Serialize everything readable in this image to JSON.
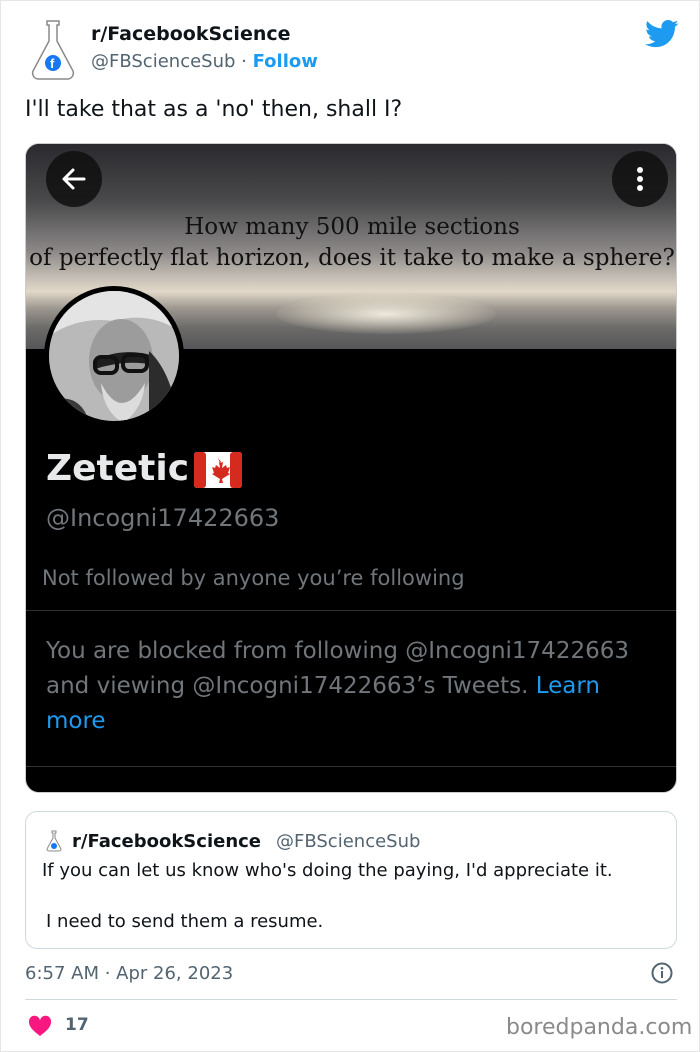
{
  "tweet": {
    "author_name": "r/FacebookScience",
    "author_handle": "@FBScienceSub",
    "separator": " · ",
    "follow_label": "Follow",
    "text": "I'll take that as a 'no' then, shall I?",
    "timestamp": "6:57 AM · Apr 26, 2023",
    "like_count": "17"
  },
  "embedded_profile": {
    "banner_line1": "How many 500 mile sections",
    "banner_line2": "of perfectly flat horizon, does it take to make a sphere?",
    "display_name": "Zetetic",
    "flag_emoji_name": "canada-flag",
    "handle": "@Incogni17422663",
    "not_followed": "Not followed by anyone you’re following",
    "blocked_text": "You are blocked from following @Incogni17422663 and viewing @Incogni17422663’s Tweets.",
    "learn_more": "Learn more"
  },
  "quoted_tweet": {
    "author_name": "r/FacebookScience",
    "author_handle": "@FBScienceSub",
    "line1": "If you can let us know who's doing the paying, I'd appreciate it.",
    "line2": "I need to send them a resume."
  },
  "watermark": "boredpanda.com",
  "colors": {
    "twitter_blue": "#1d9bf0",
    "like_red": "#f91880",
    "text_dark": "#0f1419",
    "text_gray": "#536471"
  }
}
